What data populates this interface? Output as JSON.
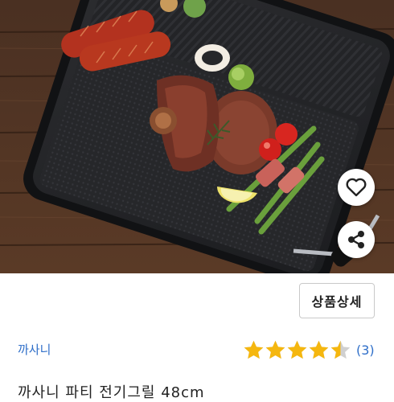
{
  "product": {
    "detail_button_label": "상품상세",
    "brand": "까사니",
    "rating_value": 4.5,
    "rating_count_label": "(3)",
    "title": "까사니 파티 전기그릴 48cm"
  },
  "icons": {
    "like": "heart-icon",
    "share": "share-icon",
    "star": "star-icon"
  },
  "colors": {
    "star": "#f5b70f",
    "star_empty": "#d0d0d0",
    "brand_link": "#2f6fc9"
  }
}
